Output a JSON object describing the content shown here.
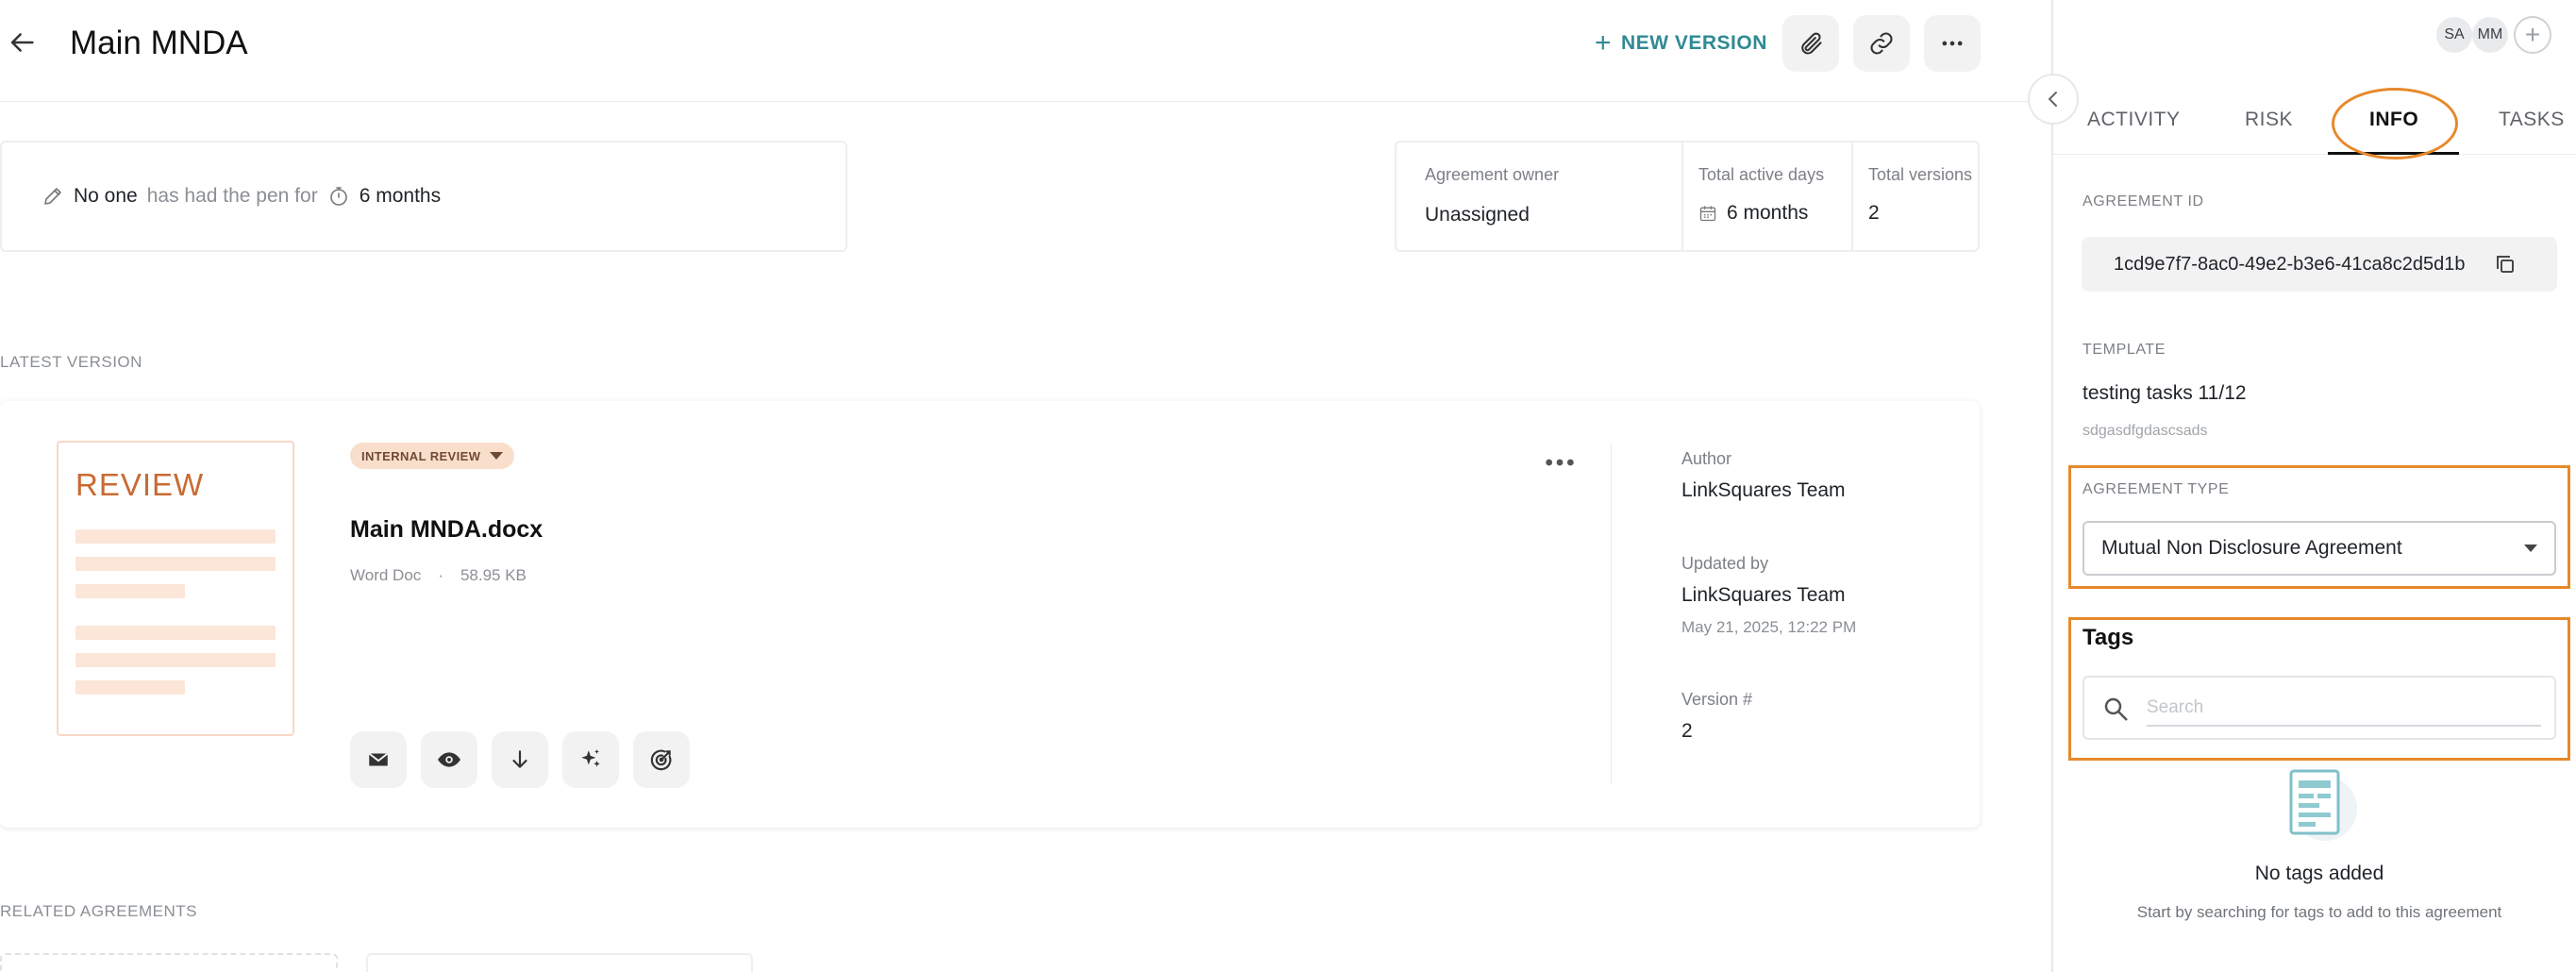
{
  "header": {
    "title": "Main MNDA",
    "new_version_label": "NEW VERSION",
    "icons": [
      "back-arrow-icon",
      "paperclip-icon",
      "link-icon",
      "more-horizontal-icon"
    ]
  },
  "pen": {
    "who": "No one",
    "text": "has had the pen for",
    "duration": "6 months"
  },
  "stats": {
    "owner_label": "Agreement owner",
    "owner_value": "Unassigned",
    "active_label": "Total active days",
    "active_value": "6 months",
    "versions_label": "Total versions",
    "versions_value": "2"
  },
  "latest": {
    "section_label": "LATEST VERSION",
    "thumbnail_text": "REVIEW",
    "badge": "INTERNAL REVIEW",
    "file_name": "Main MNDA.docx",
    "file_type": "Word Doc",
    "separator": "·",
    "file_size": "58.95 KB",
    "author_label": "Author",
    "author_value": "LinkSquares Team",
    "updated_label": "Updated by",
    "updated_value": "LinkSquares Team",
    "updated_date": "May 21, 2025, 12:22 PM",
    "version_label": "Version #",
    "version_value": "2",
    "actions": [
      "email-icon",
      "eye-icon",
      "download-icon",
      "ai-sparkle-icon",
      "target-icon"
    ]
  },
  "related": {
    "section_label": "RELATED AGREEMENTS"
  },
  "panel": {
    "avatars": [
      "SA",
      "MM"
    ],
    "add_symbol": "+",
    "tabs": [
      "ACTIVITY",
      "RISK",
      "INFO",
      "TASKS"
    ],
    "active_tab": "INFO",
    "agreement_id_label": "AGREEMENT ID",
    "agreement_id_value": "1cd9e7f7-8ac0-49e2-b3e6-41ca8c2d5d1b",
    "template_label": "TEMPLATE",
    "template_value": "testing tasks 11/12",
    "template_sub": "sdgasdfgdascsads",
    "type_label": "AGREEMENT TYPE",
    "type_value": "Mutual Non Disclosure Agreement",
    "tags_title": "Tags",
    "search_placeholder": "Search",
    "empty_title": "No tags added",
    "empty_sub": "Start by searching for tags to add to this agreement"
  },
  "colors": {
    "accent_teal": "#2f8a93",
    "highlight_orange": "#e7892a",
    "review_orange": "#c96a33",
    "badge_bg": "#f9dfcb"
  }
}
